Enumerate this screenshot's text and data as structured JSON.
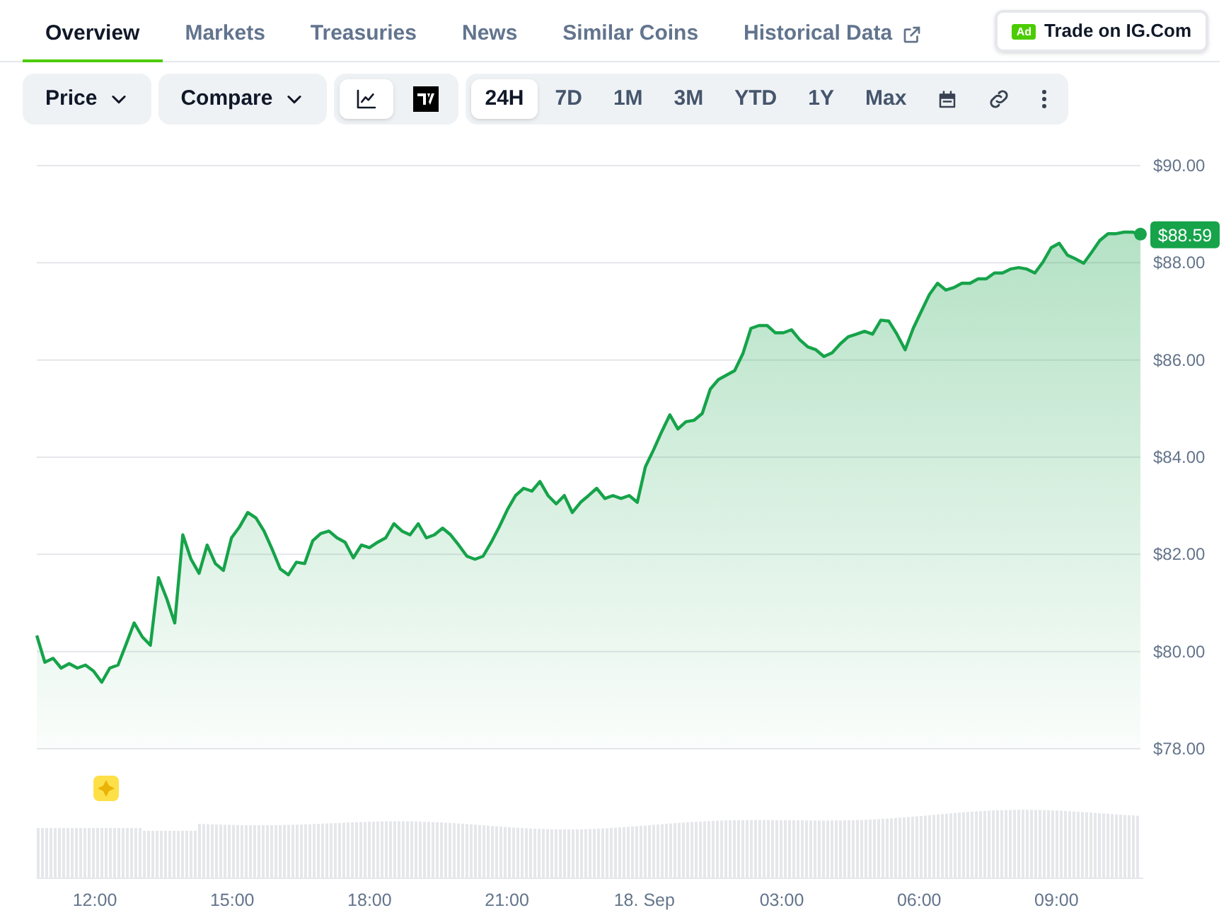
{
  "tabs": [
    {
      "label": "Overview",
      "selected": true,
      "external": false
    },
    {
      "label": "Markets",
      "selected": false,
      "external": false
    },
    {
      "label": "Treasuries",
      "selected": false,
      "external": false
    },
    {
      "label": "News",
      "selected": false,
      "external": false
    },
    {
      "label": "Similar Coins",
      "selected": false,
      "external": false
    },
    {
      "label": "Historical Data",
      "selected": false,
      "external": true
    }
  ],
  "ad_button": {
    "badge": "Ad",
    "label": "Trade on IG.Com"
  },
  "toolbar": {
    "dropdowns": [
      "Price",
      "Compare"
    ],
    "chart_styles": [
      {
        "kind": "line",
        "selected": true
      },
      {
        "kind": "candles",
        "selected": false
      }
    ],
    "ranges": [
      {
        "label": "24H",
        "selected": true
      },
      {
        "label": "7D",
        "selected": false
      },
      {
        "label": "1M",
        "selected": false
      },
      {
        "label": "3M",
        "selected": false
      },
      {
        "label": "YTD",
        "selected": false
      },
      {
        "label": "1Y",
        "selected": false
      },
      {
        "label": "Max",
        "selected": false
      }
    ]
  },
  "chart": {
    "time_labels": [
      "12:00",
      "15:00",
      "18:00",
      "21:00",
      "18. Sep",
      "03:00",
      "06:00",
      "09:00"
    ],
    "chart_data": {
      "type": "area",
      "grid": true,
      "ylim": [
        78,
        90
      ],
      "yticks": [
        {
          "value": 90,
          "label": "$90.00"
        },
        {
          "value": 88,
          "label": "$88.00"
        },
        {
          "value": 86,
          "label": "$86.00"
        },
        {
          "value": 84,
          "label": "$84.00"
        },
        {
          "value": 82,
          "label": "$82.00"
        },
        {
          "value": 80,
          "label": "$80.00"
        },
        {
          "value": 78,
          "label": "$78.00"
        }
      ],
      "series": [
        {
          "color": "#16a34a",
          "values": [
            80.33,
            79.78,
            79.86,
            79.66,
            79.75,
            79.66,
            79.72,
            79.6,
            79.37,
            79.66,
            79.72,
            80.15,
            80.59,
            80.3,
            80.13,
            81.52,
            81.09,
            80.59,
            82.4,
            81.9,
            81.61,
            82.19,
            81.81,
            81.67,
            82.34,
            82.57,
            82.86,
            82.75,
            82.48,
            82.11,
            81.7,
            81.58,
            81.84,
            81.81,
            82.28,
            82.43,
            82.48,
            82.34,
            82.25,
            81.93,
            82.19,
            82.14,
            82.25,
            82.34,
            82.63,
            82.48,
            82.4,
            82.63,
            82.34,
            82.4,
            82.54,
            82.4,
            82.19,
            81.96,
            81.9,
            81.96,
            82.25,
            82.57,
            82.92,
            83.21,
            83.36,
            83.3,
            83.5,
            83.21,
            83.04,
            83.21,
            82.86,
            83.07,
            83.21,
            83.36,
            83.15,
            83.21,
            83.15,
            83.21,
            83.07,
            83.8,
            84.15,
            84.52,
            84.87,
            84.58,
            84.73,
            84.76,
            84.9,
            85.4,
            85.6,
            85.69,
            85.78,
            86.13,
            86.65,
            86.71,
            86.71,
            86.56,
            86.56,
            86.62,
            86.42,
            86.27,
            86.21,
            86.07,
            86.15,
            86.33,
            86.48,
            86.53,
            86.59,
            86.53,
            86.82,
            86.8,
            86.53,
            86.21,
            86.65,
            87.0,
            87.35,
            87.58,
            87.44,
            87.49,
            87.58,
            87.58,
            87.67,
            87.67,
            87.79,
            87.79,
            87.87,
            87.9,
            87.87,
            87.79,
            88.02,
            88.31,
            88.4,
            88.16,
            88.08,
            87.99,
            88.22,
            88.46,
            88.6,
            88.6,
            88.63,
            88.63,
            88.59
          ]
        }
      ],
      "annotations": [
        {
          "text": "$88.59"
        }
      ]
    }
  }
}
